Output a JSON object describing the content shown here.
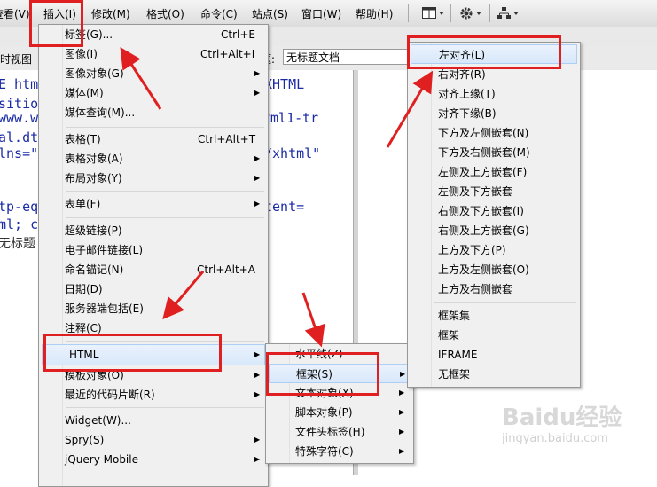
{
  "menubar": {
    "view_label": "查看(V)",
    "insert_label": "插入(I)",
    "modify_label": "修改(M)",
    "format_label": "格式(O)",
    "commands_label": "命令(C)",
    "site_label": "站点(S)",
    "window_label": "窗口(W)",
    "help_label": "帮助(H)"
  },
  "toolbar": {
    "view_mode_label": "时视图",
    "title_label": "标题:",
    "title_value": "无标题文档"
  },
  "code_lines": [
    "E htm",
    "sitio",
    "www.w",
    "al.dt",
    "lns=\"",
    "tp-eq",
    "ml; c",
    "无标题"
  ],
  "code_lines_mid": [
    "XHTML",
    "tml1-tr",
    "/xhtml\"",
    "tent="
  ],
  "insert_menu": [
    {
      "label": "标签(G)...",
      "shortcut": "Ctrl+E",
      "submenu": false
    },
    {
      "label": "图像(I)",
      "shortcut": "Ctrl+Alt+I",
      "submenu": false
    },
    {
      "label": "图像对象(G)",
      "shortcut": "",
      "submenu": true
    },
    {
      "label": "媒体(M)",
      "shortcut": "",
      "submenu": true
    },
    {
      "label": "媒体查询(M)...",
      "shortcut": "",
      "submenu": false
    },
    {
      "label": "表格(T)",
      "shortcut": "Ctrl+Alt+T",
      "submenu": false
    },
    {
      "label": "表格对象(A)",
      "shortcut": "",
      "submenu": true
    },
    {
      "label": "布局对象(Y)",
      "shortcut": "",
      "submenu": true
    },
    {
      "label": "表单(F)",
      "shortcut": "",
      "submenu": true
    },
    {
      "label": "超级链接(P)",
      "shortcut": "",
      "submenu": false
    },
    {
      "label": "电子邮件链接(L)",
      "shortcut": "",
      "submenu": false
    },
    {
      "label": "命名锚记(N)",
      "shortcut": "Ctrl+Alt+A",
      "submenu": false
    },
    {
      "label": "日期(D)",
      "shortcut": "",
      "submenu": false
    },
    {
      "label": "服务器端包括(E)",
      "shortcut": "",
      "submenu": false
    },
    {
      "label": "注释(C)",
      "shortcut": "",
      "submenu": false
    },
    {
      "label": "HTML",
      "shortcut": "",
      "submenu": true
    },
    {
      "label": "模板对象(O)",
      "shortcut": "",
      "submenu": true
    },
    {
      "label": "最近的代码片断(R)",
      "shortcut": "",
      "submenu": true
    },
    {
      "label": "Widget(W)...",
      "shortcut": "",
      "submenu": false
    },
    {
      "label": "Spry(S)",
      "shortcut": "",
      "submenu": true
    },
    {
      "label": "jQuery Mobile",
      "shortcut": "",
      "submenu": true
    }
  ],
  "html_menu": [
    {
      "label": "水平线(Z)",
      "submenu": false
    },
    {
      "label": "框架(S)",
      "submenu": true
    },
    {
      "label": "文本对象(X)",
      "submenu": true
    },
    {
      "label": "脚本对象(P)",
      "submenu": true
    },
    {
      "label": "文件头标签(H)",
      "submenu": true
    },
    {
      "label": "特殊字符(C)",
      "submenu": true
    }
  ],
  "frames_menu": [
    {
      "label": "左对齐(L)"
    },
    {
      "label": "右对齐(R)"
    },
    {
      "label": "对齐上缘(T)"
    },
    {
      "label": "对齐下缘(B)"
    },
    {
      "label": "下方及左侧嵌套(N)"
    },
    {
      "label": "下方及右侧嵌套(M)"
    },
    {
      "label": "左侧及上方嵌套(F)"
    },
    {
      "label": "左侧及下方嵌套"
    },
    {
      "label": "右侧及下方嵌套(I)"
    },
    {
      "label": "右侧及上方嵌套(G)"
    },
    {
      "label": "上方及下方(P)"
    },
    {
      "label": "上方及左侧嵌套(O)"
    },
    {
      "label": "上方及右侧嵌套"
    },
    {
      "label": "框架集"
    },
    {
      "label": "框架"
    },
    {
      "label": "IFRAME"
    },
    {
      "label": "无框架"
    }
  ],
  "watermark": {
    "brand": "Baidu经验",
    "url": "jingyan.baidu.com"
  },
  "colors": {
    "highlight_box": "#e02020",
    "arrow": "#e02020",
    "code": "#1b2ba6"
  }
}
